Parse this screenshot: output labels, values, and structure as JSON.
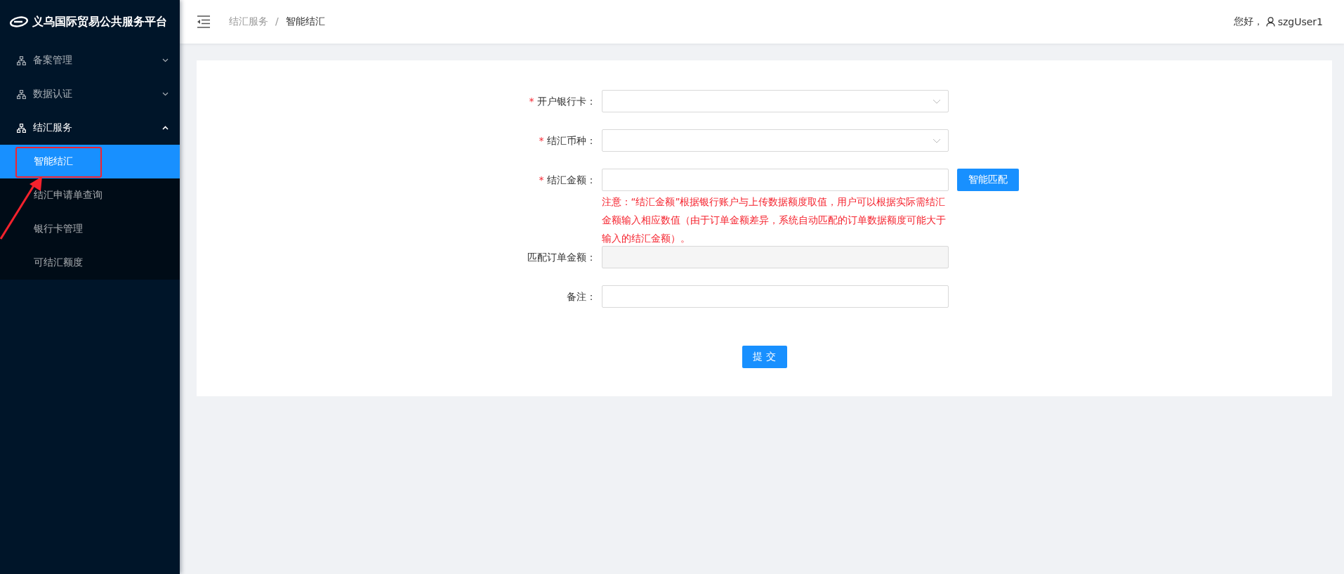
{
  "sidebar": {
    "logo_text": "义乌国际贸易公共服务平台",
    "items": [
      {
        "label": "备案管理",
        "expanded": false
      },
      {
        "label": "数据认证",
        "expanded": false
      },
      {
        "label": "结汇服务",
        "expanded": true,
        "children": [
          {
            "label": "智能结汇",
            "selected": true
          },
          {
            "label": "结汇申请单查询",
            "selected": false
          },
          {
            "label": "银行卡管理",
            "selected": false
          },
          {
            "label": "可结汇额度",
            "selected": false
          }
        ]
      }
    ]
  },
  "header": {
    "breadcrumb": [
      "结汇服务",
      "智能结汇"
    ],
    "breadcrumb_separator": "/",
    "greeting": "您好，",
    "username": "szgUser1"
  },
  "form": {
    "fields": [
      {
        "label": "开户银行卡：",
        "required_mark": "*",
        "kind": "select"
      },
      {
        "label": "结汇币种：",
        "required_mark": "*",
        "kind": "select"
      },
      {
        "label": "结汇金额：",
        "required_mark": "*",
        "kind": "input",
        "button": "智能匹配",
        "note": "注意：“结汇金额”根据银行账户与上传数据额度取值，用户可以根据实际需结汇金额输入相应数值（由于订单金额差异，系统自动匹配的订单数据额度可能大于输入的结汇金额）。"
      },
      {
        "label": "匹配订单金额：",
        "kind": "disabled"
      },
      {
        "label": "备注：",
        "kind": "input"
      }
    ],
    "submit": "提 交"
  }
}
